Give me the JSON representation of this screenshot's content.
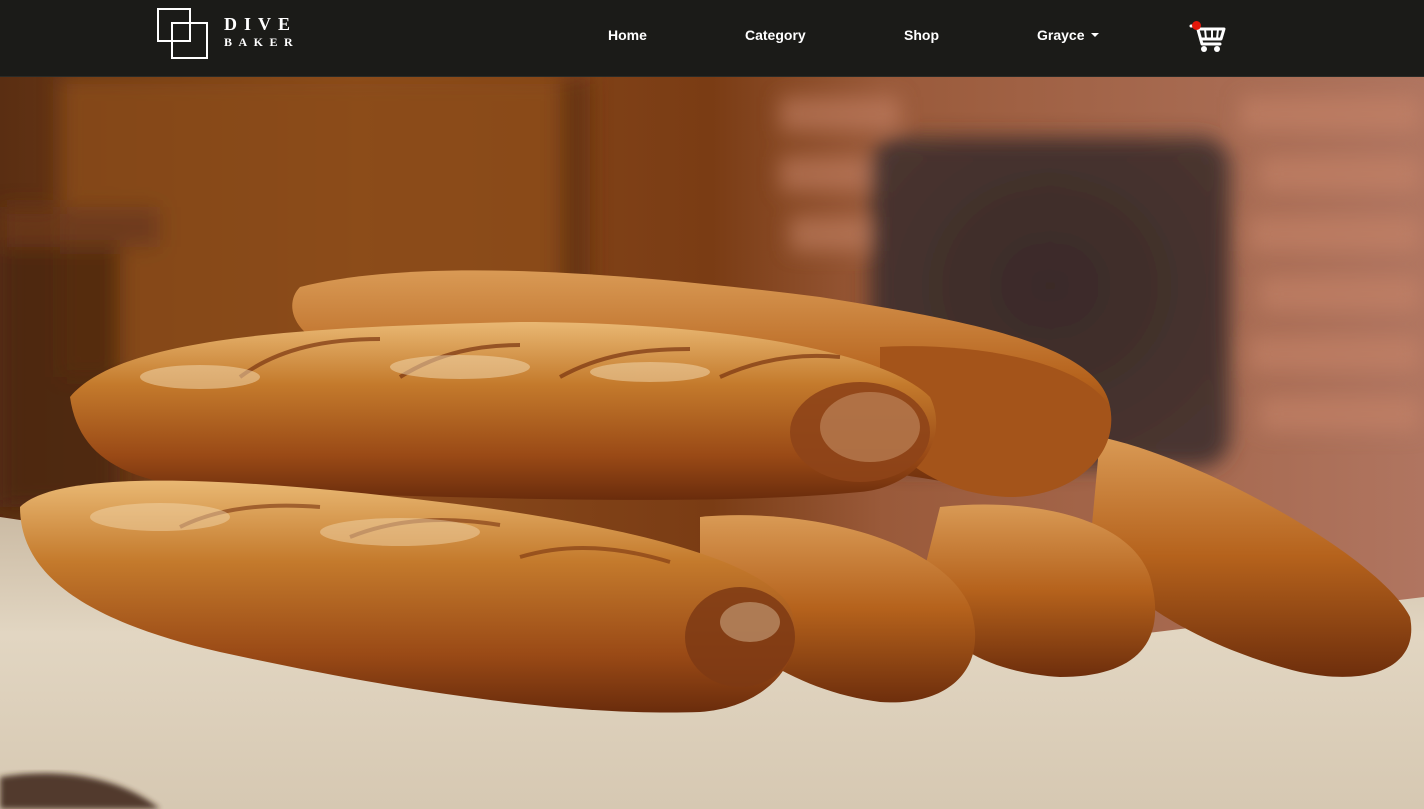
{
  "brand": {
    "name_line1": "DIVE",
    "name_line2": "BAKER",
    "logo_icon": "overlapping-squares-icon"
  },
  "nav": {
    "home": "Home",
    "category": "Category",
    "shop": "Shop",
    "user": "Grayce"
  },
  "cart": {
    "icon": "shopping-cart-icon",
    "badge_color": "#e3170a"
  },
  "hero": {
    "image_subject": "baguettes",
    "colors": {
      "crust": "#b5621c",
      "crust_dark": "#7a3410",
      "cloth": "#e6dccb",
      "wall": "#8a4a1c"
    }
  },
  "theme": {
    "navbar_bg": "#1b1b18",
    "nav_text": "#ffffff"
  }
}
